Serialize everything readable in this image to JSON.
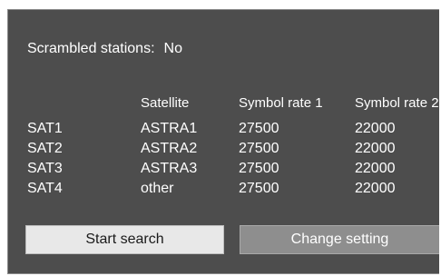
{
  "scrambled": {
    "label": "Scrambled stations:",
    "value": "No"
  },
  "table": {
    "headers": [
      "",
      "Satellite",
      "Symbol rate 1",
      "Symbol rate 2"
    ],
    "rows": [
      [
        "SAT1",
        "ASTRA1",
        "27500",
        "22000"
      ],
      [
        "SAT2",
        "ASTRA2",
        "27500",
        "22000"
      ],
      [
        "SAT3",
        "ASTRA3",
        "27500",
        "22000"
      ],
      [
        "SAT4",
        "other",
        "27500",
        "22000"
      ]
    ]
  },
  "buttons": {
    "start_search": "Start search",
    "change_setting": "Change setting"
  },
  "colors": {
    "panel_background": "#4d4d4d",
    "text": "#ffffff",
    "start_button_background": "#e8e8e8",
    "change_button_background": "#8e8e8e"
  }
}
